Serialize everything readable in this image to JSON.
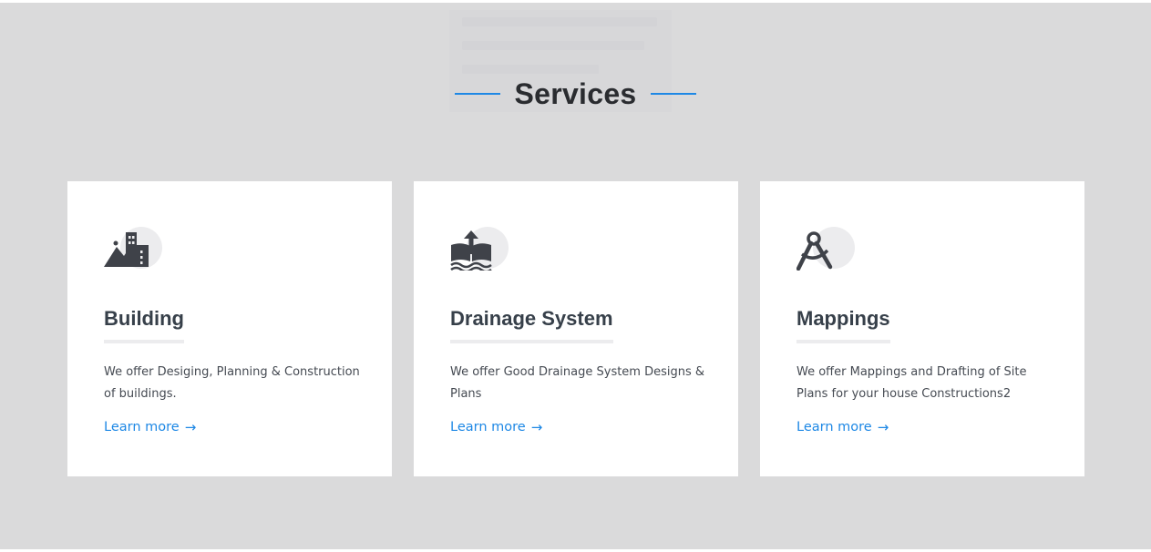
{
  "section": {
    "title": "Services",
    "accent_color": "#1e88e5",
    "background_color": "#dadadb"
  },
  "services": [
    {
      "title": "Building",
      "description": "We offer Desiging, Planning & Construction of buildings.",
      "link": "Learn more",
      "icon": "building-landscape-icon"
    },
    {
      "title": "Drainage System",
      "description": "We offer Good Drainage System Designs & Plans",
      "link": "Learn more",
      "icon": "drainage-upload-icon"
    },
    {
      "title": "Mappings",
      "description": "We offer Mappings and Drafting of Site Plans for your house Constructions2",
      "link": "Learn more",
      "icon": "drafting-compass-icon"
    }
  ],
  "arrow_glyph": "→"
}
